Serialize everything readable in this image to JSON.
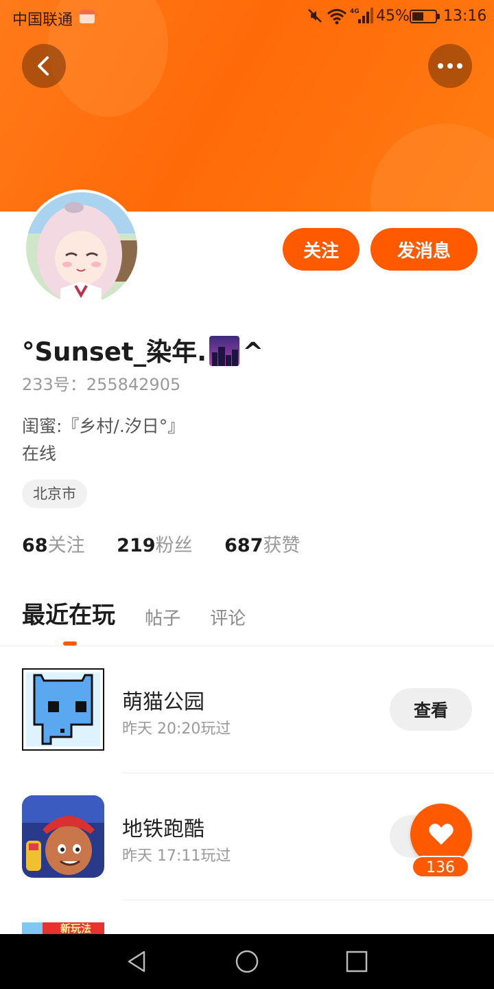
{
  "status_bar": {
    "carrier": "中国联通",
    "battery": "45%",
    "time": "13:16"
  },
  "profile": {
    "username_prefix": "°Sunset_染年.",
    "username_suffix": "^",
    "user_id": "233号：255842905",
    "bio_line1": "闺蜜:『乡村/.汐日°』",
    "bio_line2": "在线",
    "location": "北京市"
  },
  "actions": {
    "follow_label": "关注",
    "message_label": "发消息"
  },
  "stats": {
    "following_count": "68",
    "following_label": "关注",
    "followers_count": "219",
    "followers_label": "粉丝",
    "likes_count": "687",
    "likes_label": "获赞"
  },
  "tabs": [
    {
      "label": "最近在玩",
      "active": true
    },
    {
      "label": "帖子",
      "active": false
    },
    {
      "label": "评论",
      "active": false
    }
  ],
  "games": [
    {
      "title": "萌猫公园",
      "subtitle": "昨天 20:20玩过",
      "button": "查看"
    },
    {
      "title": "地铁跑酷",
      "subtitle": "昨天 17:11玩过"
    },
    {
      "badge": "新玩法"
    }
  ],
  "like_fab": {
    "count": "136"
  },
  "colors": {
    "accent": "#ff5a00",
    "banner": "#ff6a08"
  },
  "icons": [
    "back-icon",
    "more-icon",
    "heart-icon",
    "nav-back-icon",
    "nav-home-icon",
    "nav-recents-icon"
  ]
}
